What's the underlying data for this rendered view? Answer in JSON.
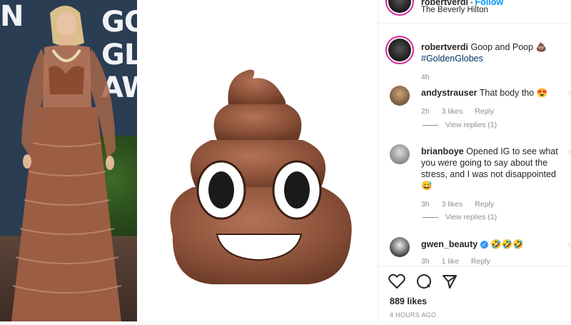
{
  "photo": {
    "backdrop_letters": "GO\nGL\nAW",
    "backdrop_edge": "N"
  },
  "post": {
    "header_username": "robertverdi",
    "header_separator": " • ",
    "header_follow": "Follow",
    "location": "The Beverly Hilton",
    "caption_username": "robertverdi",
    "caption_text": "Goop and Poop 💩",
    "caption_hashtag": "#GoldenGlobes",
    "caption_time": "4h",
    "likes": "889 likes",
    "posted": "4 HOURS AGO"
  },
  "comments": [
    {
      "username": "andystrauser",
      "text": "That body tho 😍",
      "time": "2h",
      "likes": "3 likes",
      "reply": "Reply",
      "view_replies": "View replies (1)"
    },
    {
      "username": "brianboye",
      "text": "Opened IG to see what you were going to say about the stress, and I was not disappointed 😅",
      "time": "3h",
      "likes": "3 likes",
      "reply": "Reply",
      "view_replies": "View replies (1)"
    },
    {
      "username": "gwen_beauty",
      "text": "🤣🤣🤣",
      "time": "3h",
      "likes": "1 like",
      "reply": "Reply"
    }
  ],
  "icons": [
    "heart-icon",
    "comment-icon",
    "share-icon",
    "verified-icon"
  ]
}
